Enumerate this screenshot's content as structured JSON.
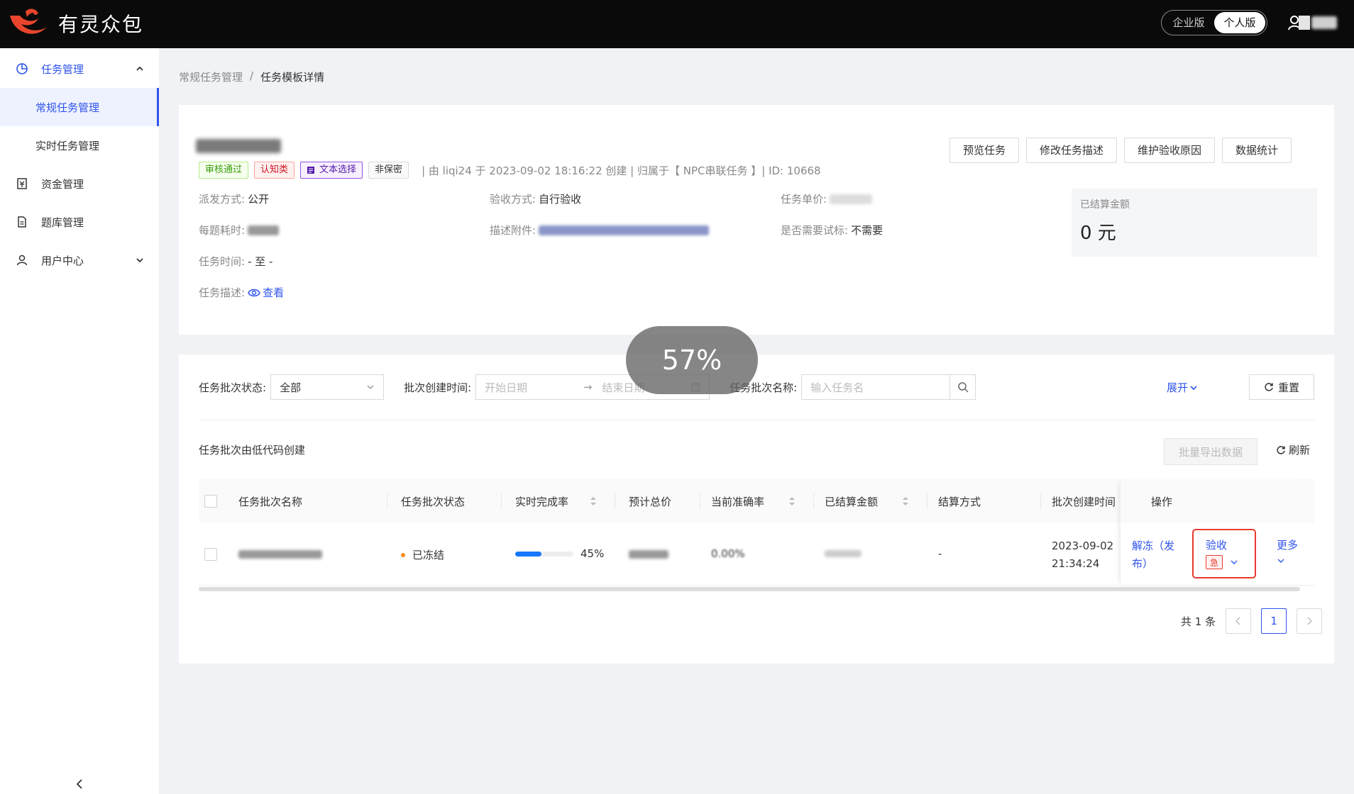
{
  "header": {
    "brand": "有灵众包",
    "version_enterprise": "企业版",
    "version_personal": "个人版"
  },
  "sidebar": {
    "task_management": "任务管理",
    "regular_tasks": "常规任务管理",
    "realtime_tasks": "实时任务管理",
    "funds": "资金管理",
    "question_bank": "题库管理",
    "user_center": "用户中心"
  },
  "breadcrumb": {
    "parent": "常规任务管理",
    "separator": "/",
    "current": "任务模板详情"
  },
  "task": {
    "tags": {
      "approved": "审核通过",
      "cognitive": "认知类",
      "text_select": "文本选择",
      "not_confidential": "非保密"
    },
    "meta": "| 由  liqi24  于  2023-09-02 18:16:22  创建 | 归属于【  NPC串联任务  】| ID:  10668",
    "actions": {
      "preview": "预览任务",
      "edit_desc": "修改任务描述",
      "maintain_reason": "维护验收原因",
      "stats": "数据统计"
    },
    "fields": {
      "dispatch_label": "派发方式:",
      "dispatch_value": "公开",
      "accept_label": "验收方式:",
      "accept_value": "自行验收",
      "price_label": "任务单价:",
      "time_per_label": "每题耗时:",
      "attach_label": "描述附件:",
      "trial_label": "是否需要试标:",
      "trial_value": "不需要",
      "period_label": "任务时间:",
      "period_value": "-  至  -",
      "desc_label": "任务描述:",
      "desc_link": "查看"
    },
    "settled_label": "已结算金额",
    "settled_value": "0 元"
  },
  "filters": {
    "status_label": "任务批次状态:",
    "status_value": "全部",
    "created_label": "批次创建时间:",
    "start_placeholder": "开始日期",
    "end_placeholder": "结束日期",
    "name_label": "任务批次名称:",
    "name_placeholder": "输入任务名",
    "expand": "展开",
    "reset": "重置"
  },
  "list": {
    "note": "任务批次由低代码创建",
    "export": "批量导出数据",
    "refresh": "刷新",
    "columns": {
      "name": "任务批次名称",
      "status": "任务批次状态",
      "completion": "实时完成率",
      "total_price": "预计总价",
      "accuracy": "当前准确率",
      "settled": "已结算金额",
      "settle_method": "结算方式",
      "created": "批次创建时间",
      "ops": "操作"
    },
    "rows": [
      {
        "status": "已冻结",
        "completion_pct": "45%",
        "completion": 0.45,
        "accuracy_partial": "0.00%",
        "settle_method": "-",
        "created_date": "2023-09-02",
        "created_time": "21:34:24",
        "op_unfreeze_1": "解冻（发",
        "op_unfreeze_2": "布）",
        "op_accept": "验收",
        "op_urgent": "急",
        "op_more": "更多"
      }
    ]
  },
  "pagination": {
    "total": "共 1 条",
    "page": "1"
  },
  "overlay": {
    "progress": "57%"
  },
  "colors": {
    "primary": "#2f54eb",
    "highlight": "#e83a2f",
    "topbar": "#0a0a0a"
  }
}
